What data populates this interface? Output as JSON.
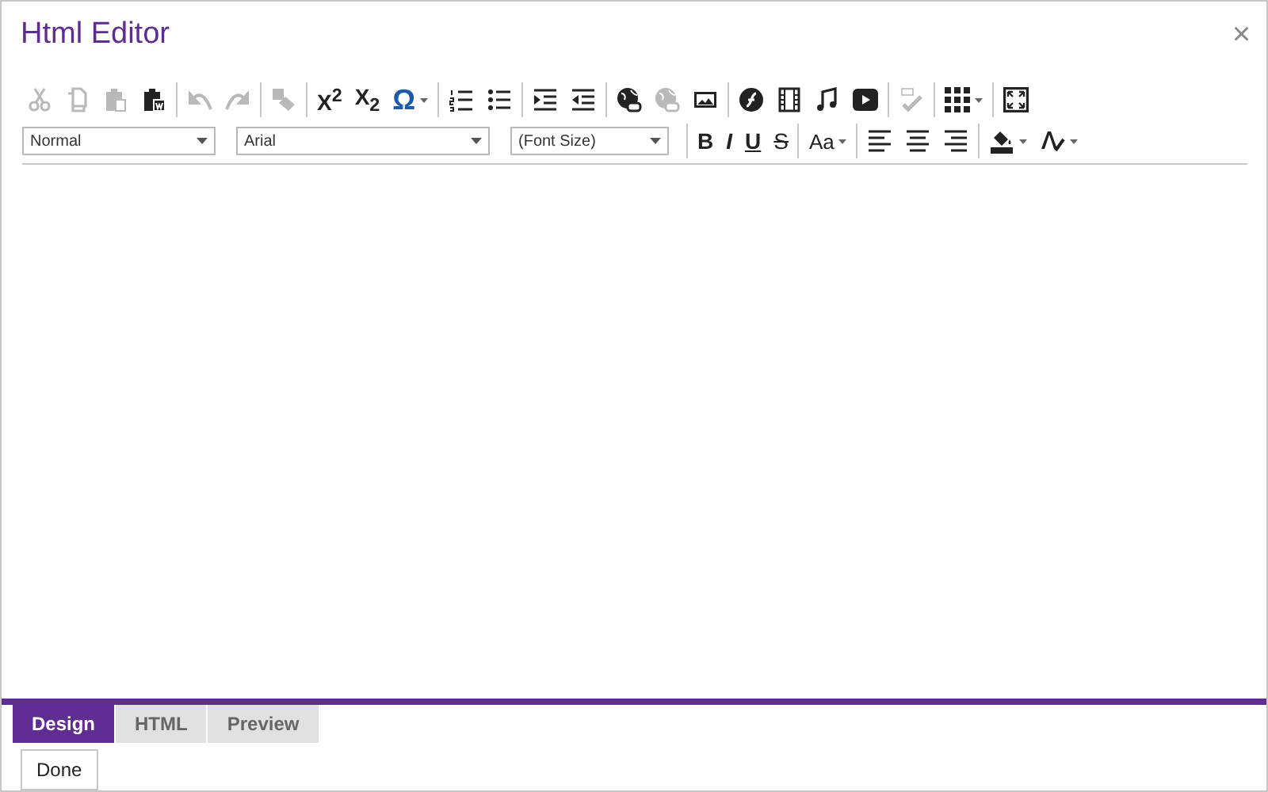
{
  "window": {
    "title": "Html Editor",
    "close": "×"
  },
  "toolbar_rows": [
    [
      [
        {
          "kind": "icon",
          "disabled": true
        },
        {
          "kind": "icon",
          "disabled": true
        },
        {
          "kind": "icon",
          "disabled": true
        },
        {
          "kind": "icon",
          "disabled": false
        }
      ],
      [
        {
          "kind": "icon",
          "disabled": true
        },
        {
          "kind": "icon",
          "disabled": true
        }
      ],
      [
        {
          "kind": "icon",
          "disabled": true
        }
      ],
      [
        {
          "kind": "glyph",
          "glyph": "X$^{2}$",
          "disabled": false
        },
        {
          "kind": "glyph",
          "glyph": "X$_{2}$",
          "disabled": false
        },
        {
          "kind": "glyph",
          "glyph": "Ω",
          "disabled": false,
          "dropdown": true
        }
      ],
      [
        {
          "kind": "icon",
          "disabled": false
        },
        {
          "kind": "icon",
          "disabled": false
        }
      ],
      [
        {
          "kind": "icon",
          "disabled": false
        },
        {
          "kind": "icon",
          "disabled": false
        }
      ],
      [
        {
          "kind": "icon",
          "disabled": false
        },
        {
          "kind": "icon",
          "disabled": true
        },
        {
          "kind": "icon",
          "disabled": false
        }
      ],
      [
        {
          "kind": "icon",
          "disabled": false
        },
        {
          "kind": "icon",
          "disabled": false
        },
        {
          "kind": "icon",
          "disabled": false
        },
        {
          "kind": "icon",
          "disabled": false
        }
      ],
      [
        {
          "kind": "icon",
          "disabled": true
        }
      ],
      [
        {
          "kind": "icon",
          "disabled": false,
          "dropdown": true
        }
      ],
      [
        {
          "kind": "icon",
          "disabled": false
        }
      ]
    ],
    [
      [
        {
          "kind": "select",
          "value": "Normal"
        },
        {
          "kind": "select",
          "value": "Arial"
        },
        {
          "kind": "select",
          "value": "(Font Size)"
        }
      ],
      [
        {
          "kind": "glyph",
          "glyph": "B",
          "disabled": false
        },
        {
          "kind": "glyph",
          "glyph": "I",
          "disabled": false
        },
        {
          "kind": "glyph",
          "glyph": "U",
          "disabled": false
        },
        {
          "kind": "glyph",
          "glyph": "S",
          "disabled": false
        }
      ],
      [
        {
          "kind": "glyph",
          "glyph": "Aa",
          "disabled": false,
          "dropdown": true
        }
      ],
      [
        {
          "kind": "icon",
          "disabled": false
        },
        {
          "kind": "icon",
          "disabled": false
        },
        {
          "kind": "icon",
          "disabled": false
        }
      ],
      [
        {
          "kind": "icon",
          "disabled": false,
          "dropdown": true
        },
        {
          "kind": "icon",
          "disabled": false,
          "dropdown": true
        }
      ]
    ]
  ],
  "tabs": [
    {
      "label": "Design",
      "selected": true
    },
    {
      "label": "HTML",
      "selected": false
    },
    {
      "label": "Preview",
      "selected": false
    }
  ],
  "buttons": [
    "Done"
  ]
}
